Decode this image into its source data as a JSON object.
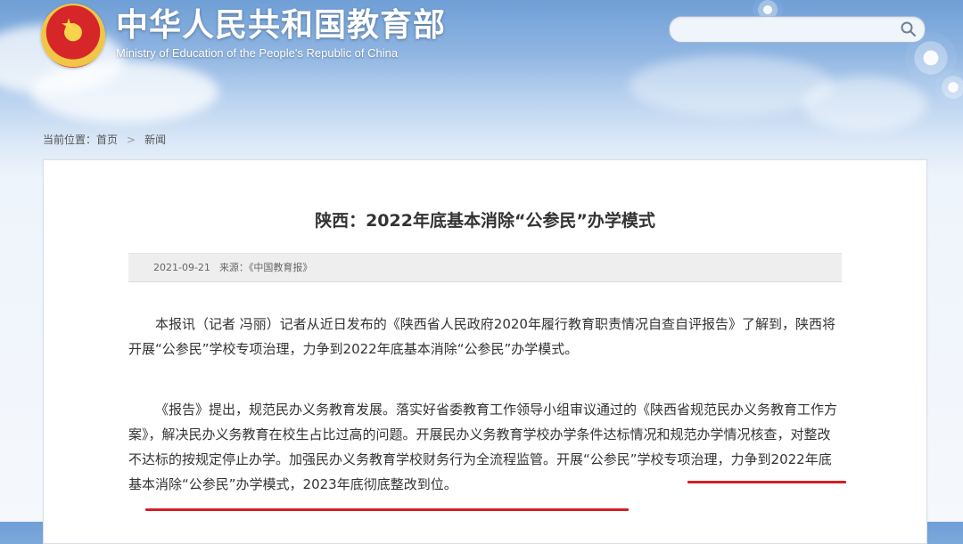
{
  "site": {
    "title": "中华人民共和国教育部",
    "subtitle": "Ministry of Education of the People's Republic of China"
  },
  "search": {
    "placeholder": "",
    "value": ""
  },
  "breadcrumb": {
    "prefix": "当前位置：",
    "home": "首页",
    "separator": ">",
    "current": "新闻"
  },
  "article": {
    "title": "陕西：2022年底基本消除“公参民”办学模式",
    "date": "2021-09-21",
    "source_label": "来源：",
    "source_value": "《中国教育报》",
    "paragraphs": [
      "本报讯（记者 冯丽）记者从近日发布的《陕西省人民政府2020年履行教育职责情况自查自评报告》了解到，陕西将开展“公参民”学校专项治理，力争到2022年底基本消除“公参民”办学模式。",
      "《报告》提出，规范民办义务教育发展。落实好省委教育工作领导小组审议通过的《陕西省规范民办义务教育工作方案》，解决民办义务教育在校生占比过高的问题。开展民办义务教育学校办学条件达标情况和规范办学情况核查，对整改不达标的按规定停止办学。加强民办义务教育学校财务行为全流程监管。开展“公参民”学校专项治理，力争到2022年底基本消除“公参民”办学模式，2023年底彻底整改到位。"
    ]
  },
  "colors": {
    "header_blue": "#6f9fd6",
    "panel_bg": "#ffffff",
    "meta_bg": "#eeeeee",
    "emphasis_red": "#d51f25",
    "text": "#333333"
  },
  "icons": {
    "search": "search-icon",
    "emblem": "national-emblem"
  }
}
